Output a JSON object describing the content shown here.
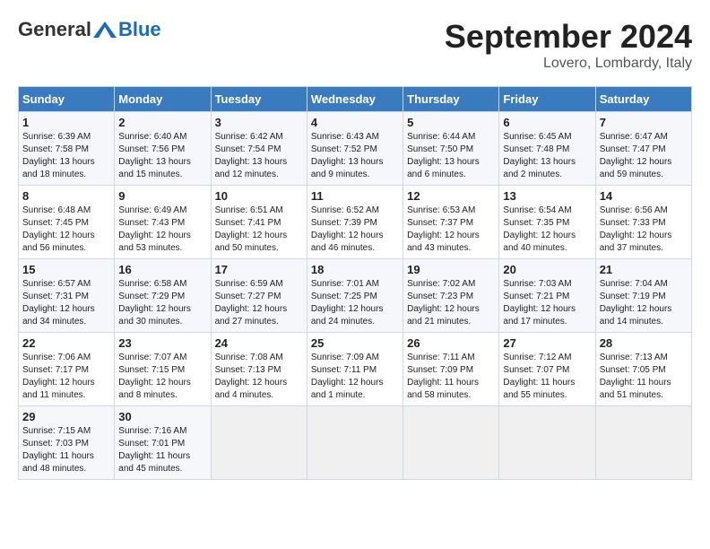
{
  "header": {
    "logo_general": "General",
    "logo_blue": "Blue",
    "month": "September 2024",
    "location": "Lovero, Lombardy, Italy"
  },
  "weekdays": [
    "Sunday",
    "Monday",
    "Tuesday",
    "Wednesday",
    "Thursday",
    "Friday",
    "Saturday"
  ],
  "weeks": [
    [
      {
        "day": "1",
        "lines": [
          "Sunrise: 6:39 AM",
          "Sunset: 7:58 PM",
          "Daylight: 13 hours",
          "and 18 minutes."
        ]
      },
      {
        "day": "2",
        "lines": [
          "Sunrise: 6:40 AM",
          "Sunset: 7:56 PM",
          "Daylight: 13 hours",
          "and 15 minutes."
        ]
      },
      {
        "day": "3",
        "lines": [
          "Sunrise: 6:42 AM",
          "Sunset: 7:54 PM",
          "Daylight: 13 hours",
          "and 12 minutes."
        ]
      },
      {
        "day": "4",
        "lines": [
          "Sunrise: 6:43 AM",
          "Sunset: 7:52 PM",
          "Daylight: 13 hours",
          "and 9 minutes."
        ]
      },
      {
        "day": "5",
        "lines": [
          "Sunrise: 6:44 AM",
          "Sunset: 7:50 PM",
          "Daylight: 13 hours",
          "and 6 minutes."
        ]
      },
      {
        "day": "6",
        "lines": [
          "Sunrise: 6:45 AM",
          "Sunset: 7:48 PM",
          "Daylight: 13 hours",
          "and 2 minutes."
        ]
      },
      {
        "day": "7",
        "lines": [
          "Sunrise: 6:47 AM",
          "Sunset: 7:47 PM",
          "Daylight: 12 hours",
          "and 59 minutes."
        ]
      }
    ],
    [
      {
        "day": "8",
        "lines": [
          "Sunrise: 6:48 AM",
          "Sunset: 7:45 PM",
          "Daylight: 12 hours",
          "and 56 minutes."
        ]
      },
      {
        "day": "9",
        "lines": [
          "Sunrise: 6:49 AM",
          "Sunset: 7:43 PM",
          "Daylight: 12 hours",
          "and 53 minutes."
        ]
      },
      {
        "day": "10",
        "lines": [
          "Sunrise: 6:51 AM",
          "Sunset: 7:41 PM",
          "Daylight: 12 hours",
          "and 50 minutes."
        ]
      },
      {
        "day": "11",
        "lines": [
          "Sunrise: 6:52 AM",
          "Sunset: 7:39 PM",
          "Daylight: 12 hours",
          "and 46 minutes."
        ]
      },
      {
        "day": "12",
        "lines": [
          "Sunrise: 6:53 AM",
          "Sunset: 7:37 PM",
          "Daylight: 12 hours",
          "and 43 minutes."
        ]
      },
      {
        "day": "13",
        "lines": [
          "Sunrise: 6:54 AM",
          "Sunset: 7:35 PM",
          "Daylight: 12 hours",
          "and 40 minutes."
        ]
      },
      {
        "day": "14",
        "lines": [
          "Sunrise: 6:56 AM",
          "Sunset: 7:33 PM",
          "Daylight: 12 hours",
          "and 37 minutes."
        ]
      }
    ],
    [
      {
        "day": "15",
        "lines": [
          "Sunrise: 6:57 AM",
          "Sunset: 7:31 PM",
          "Daylight: 12 hours",
          "and 34 minutes."
        ]
      },
      {
        "day": "16",
        "lines": [
          "Sunrise: 6:58 AM",
          "Sunset: 7:29 PM",
          "Daylight: 12 hours",
          "and 30 minutes."
        ]
      },
      {
        "day": "17",
        "lines": [
          "Sunrise: 6:59 AM",
          "Sunset: 7:27 PM",
          "Daylight: 12 hours",
          "and 27 minutes."
        ]
      },
      {
        "day": "18",
        "lines": [
          "Sunrise: 7:01 AM",
          "Sunset: 7:25 PM",
          "Daylight: 12 hours",
          "and 24 minutes."
        ]
      },
      {
        "day": "19",
        "lines": [
          "Sunrise: 7:02 AM",
          "Sunset: 7:23 PM",
          "Daylight: 12 hours",
          "and 21 minutes."
        ]
      },
      {
        "day": "20",
        "lines": [
          "Sunrise: 7:03 AM",
          "Sunset: 7:21 PM",
          "Daylight: 12 hours",
          "and 17 minutes."
        ]
      },
      {
        "day": "21",
        "lines": [
          "Sunrise: 7:04 AM",
          "Sunset: 7:19 PM",
          "Daylight: 12 hours",
          "and 14 minutes."
        ]
      }
    ],
    [
      {
        "day": "22",
        "lines": [
          "Sunrise: 7:06 AM",
          "Sunset: 7:17 PM",
          "Daylight: 12 hours",
          "and 11 minutes."
        ]
      },
      {
        "day": "23",
        "lines": [
          "Sunrise: 7:07 AM",
          "Sunset: 7:15 PM",
          "Daylight: 12 hours",
          "and 8 minutes."
        ]
      },
      {
        "day": "24",
        "lines": [
          "Sunrise: 7:08 AM",
          "Sunset: 7:13 PM",
          "Daylight: 12 hours",
          "and 4 minutes."
        ]
      },
      {
        "day": "25",
        "lines": [
          "Sunrise: 7:09 AM",
          "Sunset: 7:11 PM",
          "Daylight: 12 hours",
          "and 1 minute."
        ]
      },
      {
        "day": "26",
        "lines": [
          "Sunrise: 7:11 AM",
          "Sunset: 7:09 PM",
          "Daylight: 11 hours",
          "and 58 minutes."
        ]
      },
      {
        "day": "27",
        "lines": [
          "Sunrise: 7:12 AM",
          "Sunset: 7:07 PM",
          "Daylight: 11 hours",
          "and 55 minutes."
        ]
      },
      {
        "day": "28",
        "lines": [
          "Sunrise: 7:13 AM",
          "Sunset: 7:05 PM",
          "Daylight: 11 hours",
          "and 51 minutes."
        ]
      }
    ],
    [
      {
        "day": "29",
        "lines": [
          "Sunrise: 7:15 AM",
          "Sunset: 7:03 PM",
          "Daylight: 11 hours",
          "and 48 minutes."
        ]
      },
      {
        "day": "30",
        "lines": [
          "Sunrise: 7:16 AM",
          "Sunset: 7:01 PM",
          "Daylight: 11 hours",
          "and 45 minutes."
        ]
      },
      null,
      null,
      null,
      null,
      null
    ]
  ]
}
